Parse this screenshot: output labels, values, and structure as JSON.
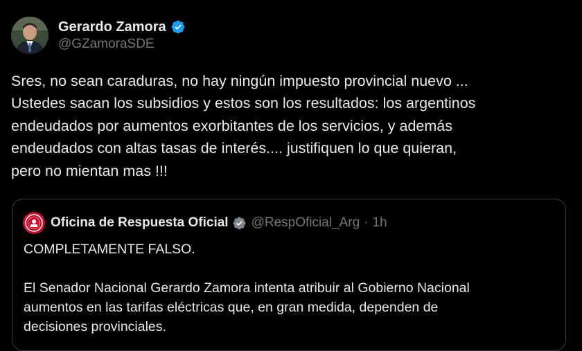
{
  "post": {
    "author": {
      "display_name": "Gerardo Zamora",
      "handle": "@GZamoraSDE",
      "verified": true,
      "avatar_icon": "profile-photo",
      "verified_icon": "verified-badge-icon"
    },
    "text_lines": [
      "Sres, no sean caraduras, no hay ningún impuesto provincial nuevo ...",
      "Ustedes sacan los subsidios y  estos son los resultados: los  argentinos",
      "endeudados por aumentos exorbitantes de los servicios, y además",
      "endeudados con altas tasas de interés.... justifiquen lo  que quieran,",
      "pero no mientan mas !!!"
    ]
  },
  "quoted_post": {
    "author": {
      "display_name": "Oficina de Respuesta Oficial",
      "handle": "@RespOficial_Arg",
      "separator": "·",
      "time": "1h",
      "verified": true,
      "avatar_icon": "official-seal-icon",
      "verified_icon": "verified-badge-icon"
    },
    "headline": "COMPLETAMENTE FALSO.",
    "body_lines": [
      "El Senador Nacional Gerardo Zamora intenta atribuir al Gobierno Nacional",
      "aumentos en las tarifas eléctricas que, en gran medida, dependen de",
      "decisiones provinciales."
    ]
  },
  "colors": {
    "background": "#000000",
    "primary_text": "#e7e9ea",
    "secondary_text": "#71767b",
    "verified_badge": "#1d9bf0",
    "quote_border": "#3a3d41",
    "seal_red": "#c8102e"
  }
}
